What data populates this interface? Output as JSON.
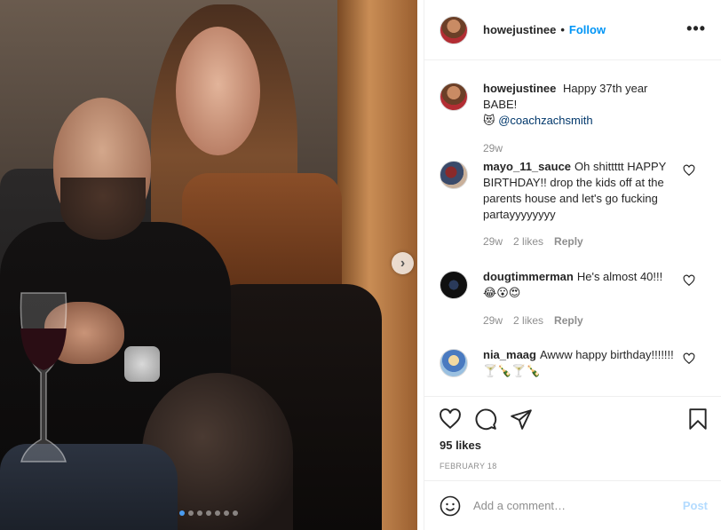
{
  "post": {
    "author": "howejustinee",
    "follow_label": "Follow",
    "separator": "•",
    "more_label": "•••",
    "carousel_count": 7,
    "carousel_active": 1
  },
  "caption": {
    "username": "howejustinee",
    "text": "Happy 37th year BABE!",
    "emoji": "😻",
    "mention": "@coachzachsmith",
    "time": "29w"
  },
  "comments": [
    {
      "username": "mayo_11_sauce",
      "text": "Oh shittttt HAPPY BIRTHDAY!! drop the kids off at the parents house and let's go fucking partayyyyyyyy",
      "time": "29w",
      "likes": "2 likes",
      "reply": "Reply"
    },
    {
      "username": "dougtimmerman",
      "text": "He's almost 40!!!",
      "emoji": "😂😮😍",
      "time": "29w",
      "likes": "2 likes",
      "reply": "Reply"
    },
    {
      "username": "nia_maag",
      "text": "Awww happy birthday!!!!!!!",
      "emoji": "🍸🍾🍸🍾"
    }
  ],
  "stats": {
    "likes": "95 likes",
    "date": "FEBRUARY 18"
  },
  "composer": {
    "placeholder": "Add a comment…",
    "post_label": "Post"
  }
}
